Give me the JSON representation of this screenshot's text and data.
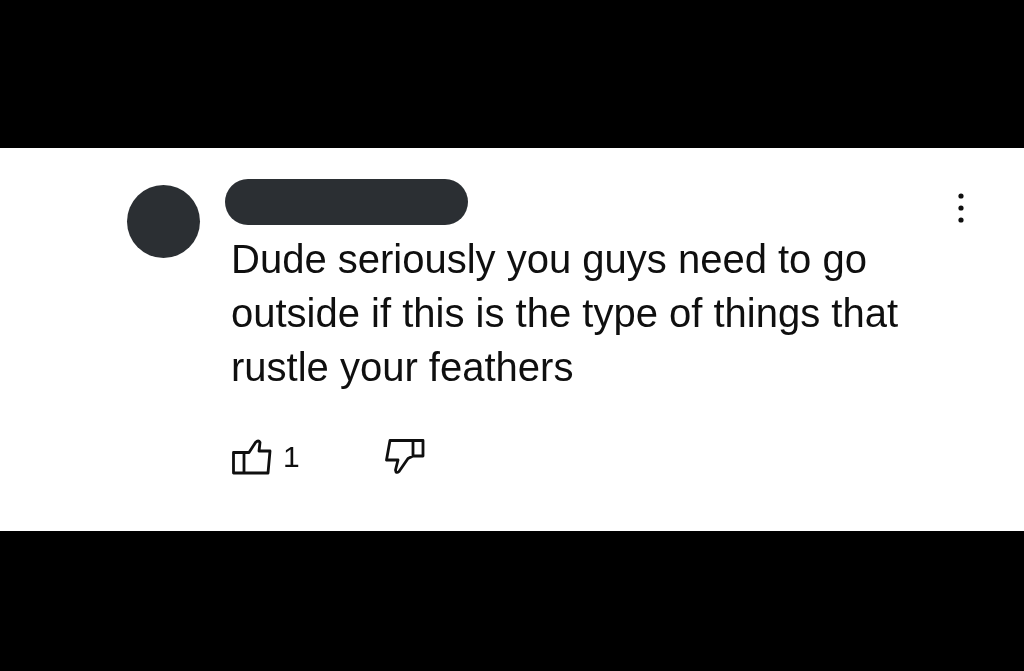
{
  "comment": {
    "text": "Dude seriously you guys need to go outside if this is the type of things that rustle your feathers",
    "actions": {
      "likes": "1",
      "liked": false,
      "disliked": false
    }
  }
}
